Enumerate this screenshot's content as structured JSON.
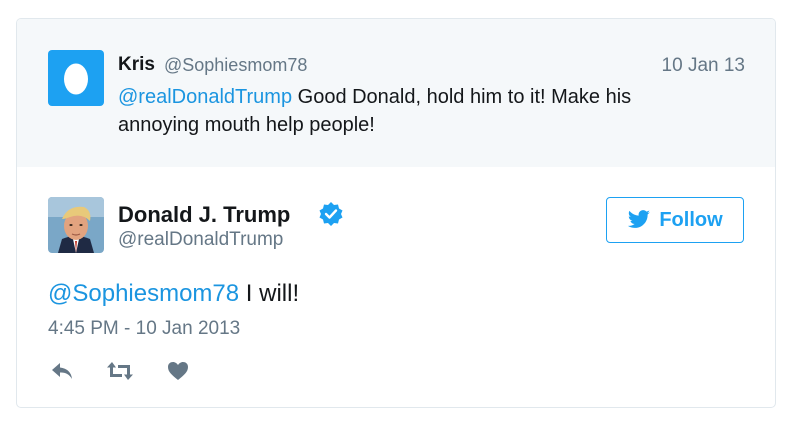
{
  "reply_to": {
    "name": "Kris",
    "handle": "@Sophiesmom78",
    "date": "10 Jan 13",
    "mention": "@realDonaldTrump",
    "text": " Good Donald, hold him to it! Make his annoying mouth help people!",
    "avatar_icon": "egg-icon"
  },
  "main_tweet": {
    "name": "Donald J. Trump",
    "handle": "@realDonaldTrump",
    "verified_icon": "verified-badge-icon",
    "follow_label": "Follow",
    "mention": "@Sophiesmom78",
    "text": " I will!",
    "timestamp": "4:45 PM - 10 Jan 2013",
    "actions": [
      "reply-icon",
      "retweet-icon",
      "like-icon"
    ]
  },
  "colors": {
    "accent": "#1da1f2",
    "link": "#1b95e0",
    "muted": "#657786",
    "reply_bg": "#f5f8fa"
  }
}
